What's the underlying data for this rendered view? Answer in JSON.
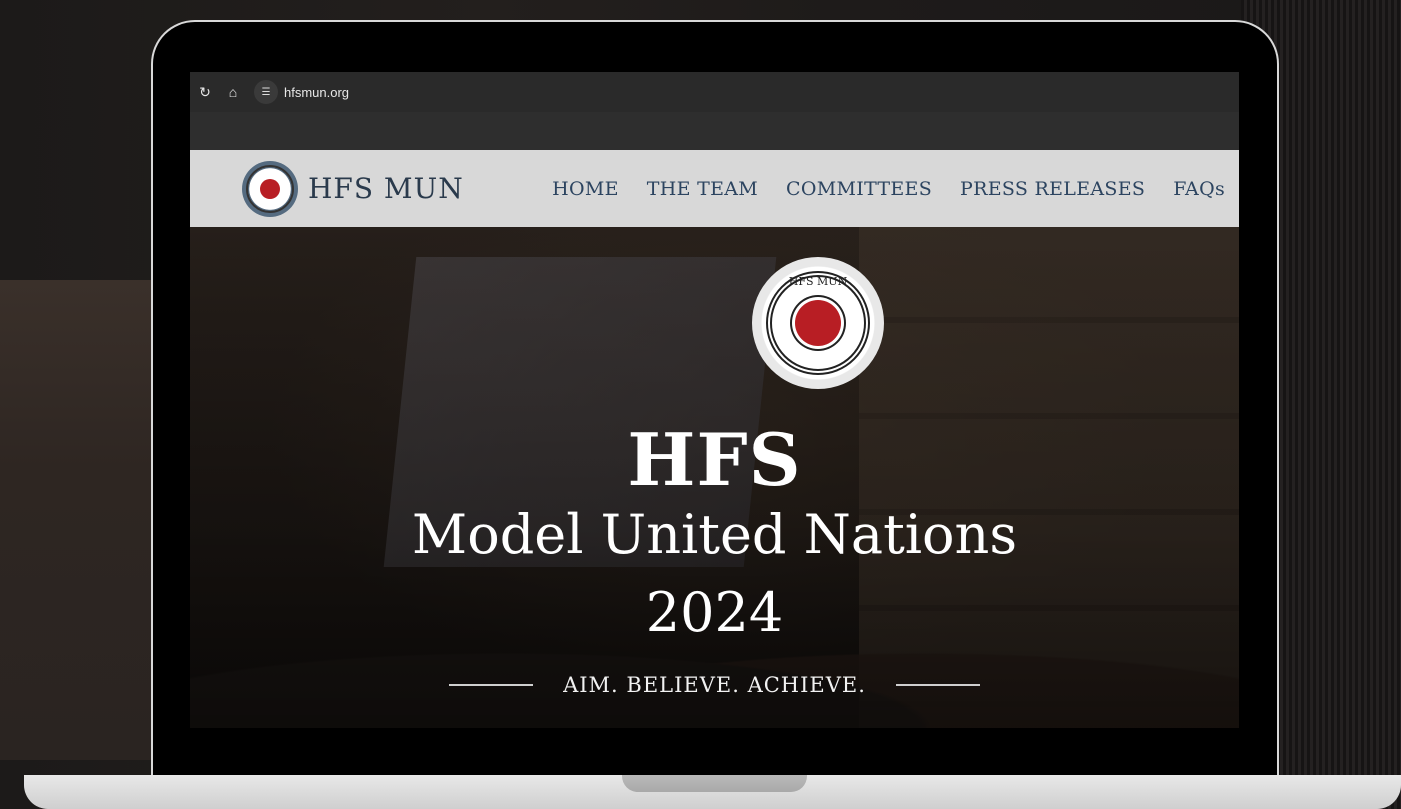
{
  "browser": {
    "url": "hfsmun.org"
  },
  "site": {
    "brand_name": "HFS MUN",
    "logo_text": "HFS MUN",
    "nav": [
      {
        "label": "HOME"
      },
      {
        "label": "THE TEAM"
      },
      {
        "label": "COMMITTEES"
      },
      {
        "label": "PRESS RELEASES"
      },
      {
        "label": "FAQs"
      }
    ]
  },
  "hero": {
    "title": "HFS",
    "subtitle": "Model United Nations",
    "year": "2024",
    "tagline": "AIM. BELIEVE. ACHIEVE."
  },
  "colors": {
    "header_bg": "#d8d8d8",
    "nav_text": "#2c4460",
    "logo_red": "#b81e24"
  }
}
